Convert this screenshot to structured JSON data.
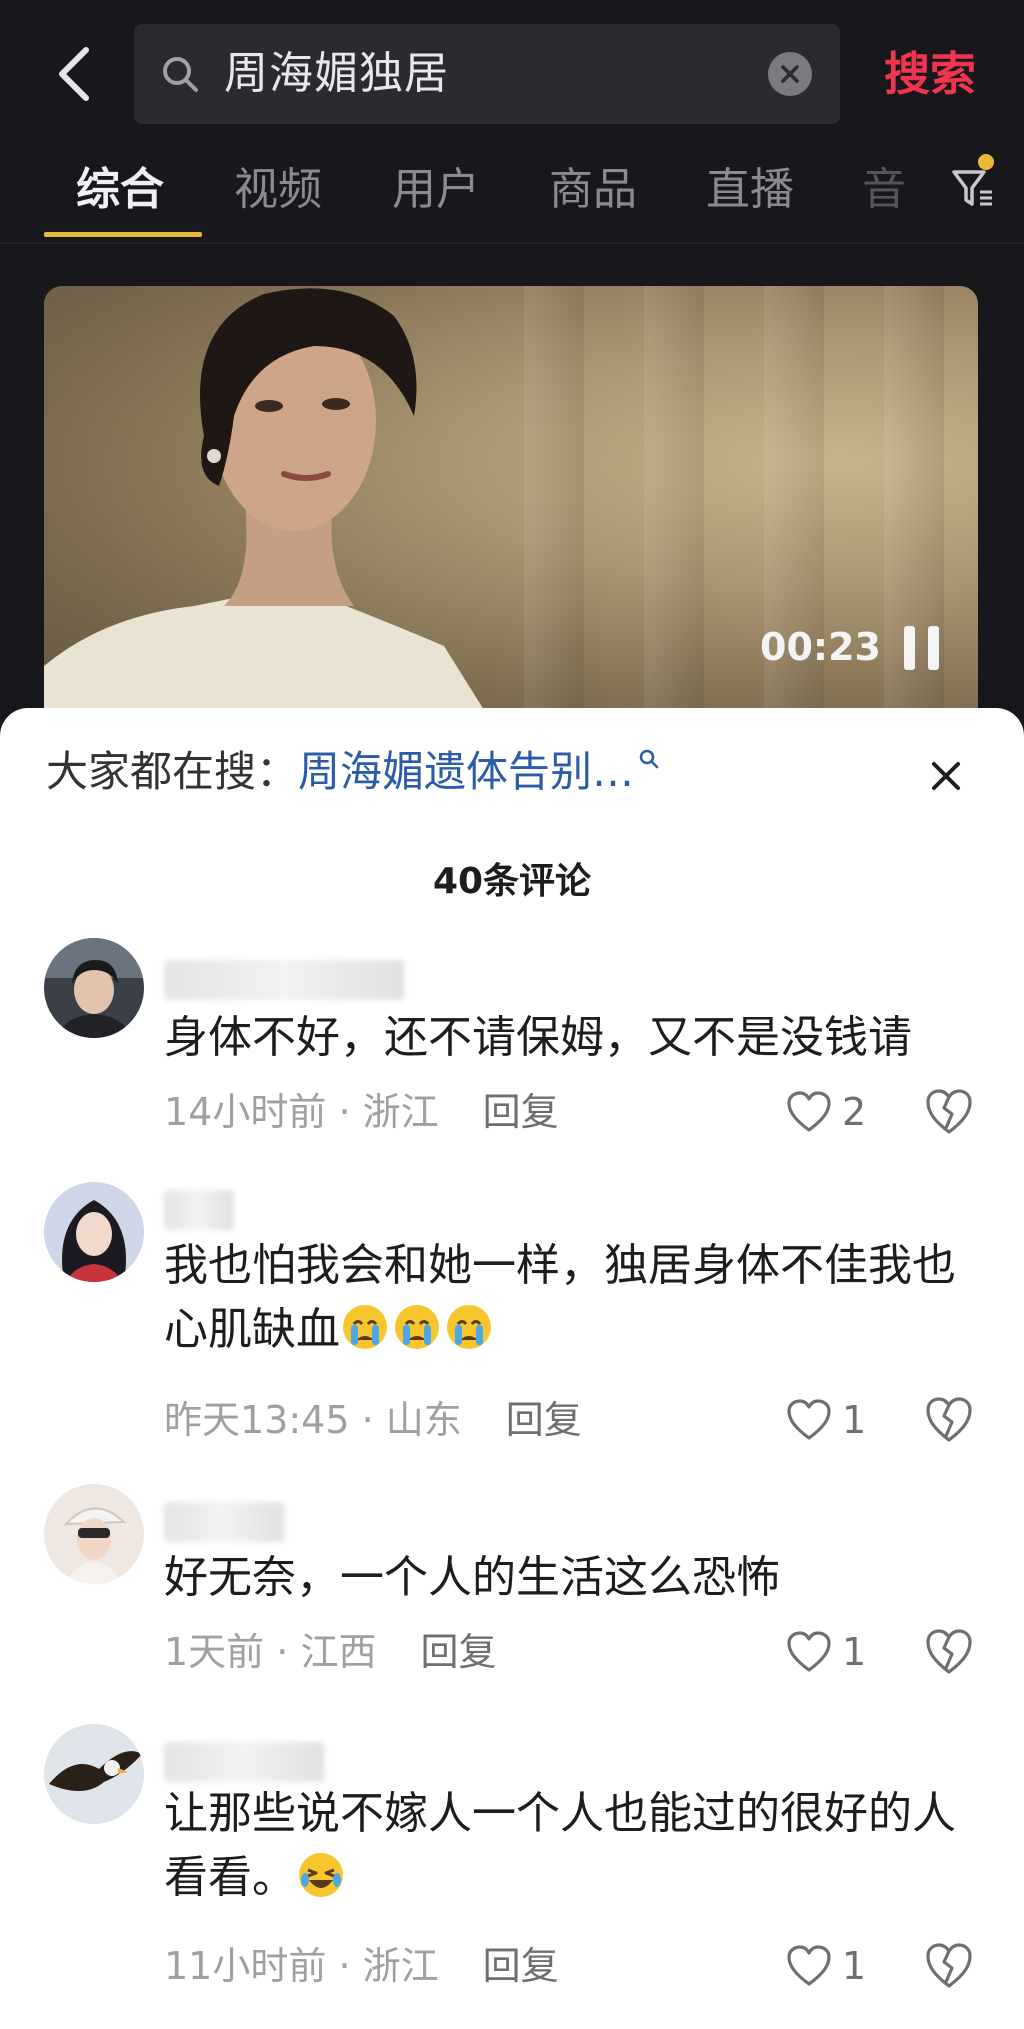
{
  "search": {
    "query": "周海媚独居",
    "submit_label": "搜索"
  },
  "tabs": [
    {
      "label": "综合"
    },
    {
      "label": "视频"
    },
    {
      "label": "用户"
    },
    {
      "label": "商品"
    },
    {
      "label": "直播"
    },
    {
      "label": "音"
    }
  ],
  "video": {
    "time": "00:23"
  },
  "comments_panel": {
    "hot_search_prefix": "大家都在搜：",
    "hot_search_link": "周海媚遗体告别…",
    "count_label": "40条评论"
  },
  "comments": [
    {
      "text": "身体不好，还不请保姆，又不是没钱请",
      "time": "14小时前",
      "location": "浙江",
      "reply_label": "回复",
      "likes": "2"
    },
    {
      "text": "我也怕我会和她一样，独居身体不佳我也心肌缺血",
      "time": "昨天13:45",
      "location": "山东",
      "reply_label": "回复",
      "likes": "1"
    },
    {
      "text": "好无奈，一个人的生活这么恐怖",
      "time": "1天前",
      "location": "江西",
      "reply_label": "回复",
      "likes": "1"
    },
    {
      "text": "让那些说不嫁人一个人也能过的很好的人看看。",
      "time": "11小时前",
      "location": "浙江",
      "reply_label": "回复",
      "likes": "1"
    }
  ],
  "colors": {
    "accent": "#f0364f",
    "tab_indicator": "#e8b93a",
    "link": "#2a5ca8"
  },
  "icons": [
    "back-arrow-icon",
    "search-icon",
    "clear-icon",
    "filter-icon",
    "pause-icon",
    "close-icon",
    "heart-icon",
    "broken-heart-icon",
    "crying-emoji-icon",
    "laughing-emoji-icon"
  ]
}
